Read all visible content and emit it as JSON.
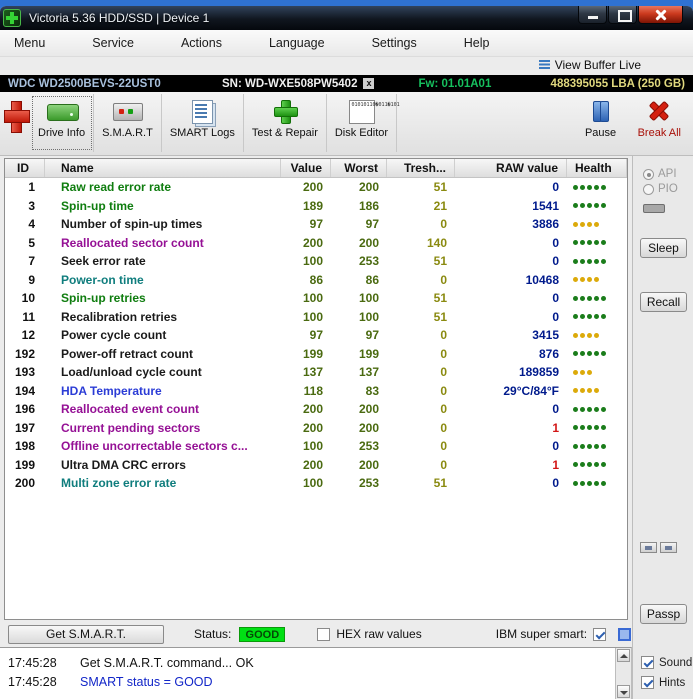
{
  "window": {
    "title": "Victoria 5.36 HDD/SSD | Device 1"
  },
  "menu": {
    "items": [
      "Menu",
      "Service",
      "Actions",
      "Language",
      "Settings",
      "Help"
    ]
  },
  "view_buffer_label": "View Buffer Live",
  "device_bar": {
    "model": "WDC WD2500BEVS-22UST0",
    "serial": "SN: WD-WXE508PW5402",
    "close_x": "x",
    "firmware": "Fw: 01.01A01",
    "capacity": "488395055 LBA (250 GB)"
  },
  "toolbar": {
    "buttons": [
      {
        "label": "Drive Info",
        "icon": "drive-info-icon"
      },
      {
        "label": "S.M.A.R.T",
        "icon": "smart-icon"
      },
      {
        "label": "SMART Logs",
        "icon": "smart-logs-icon"
      },
      {
        "label": "Test & Repair",
        "icon": "test-repair-icon"
      },
      {
        "label": "Disk Editor",
        "icon": "disk-editor-icon"
      }
    ],
    "pause_label": "Pause",
    "break_label": "Break All"
  },
  "table": {
    "headers": [
      "ID",
      "Name",
      "Value",
      "Worst",
      "Tresh...",
      "RAW value",
      "Health"
    ],
    "rows": [
      {
        "id": "1",
        "name": "Raw read error rate",
        "name_color": "#0f7d0f",
        "value": "200",
        "worst": "200",
        "tresh": "51",
        "raw": "0",
        "raw_color": "#001a8c",
        "dots": 5,
        "dot_color": "#1b7d1b"
      },
      {
        "id": "3",
        "name": "Spin-up time",
        "name_color": "#0f7d0f",
        "value": "189",
        "worst": "186",
        "tresh": "21",
        "raw": "1541",
        "raw_color": "#001a8c",
        "dots": 5,
        "dot_color": "#1b7d1b"
      },
      {
        "id": "4",
        "name": "Number of spin-up times",
        "name_color": "#1a1a1a",
        "value": "97",
        "worst": "97",
        "tresh": "0",
        "raw": "3886",
        "raw_color": "#001a8c",
        "dots": 4,
        "dot_color": "#dcaa0a"
      },
      {
        "id": "5",
        "name": "Reallocated sector count",
        "name_color": "#951095",
        "value": "200",
        "worst": "200",
        "tresh": "140",
        "raw": "0",
        "raw_color": "#001a8c",
        "dots": 5,
        "dot_color": "#1b7d1b"
      },
      {
        "id": "7",
        "name": "Seek error rate",
        "name_color": "#1a1a1a",
        "value": "100",
        "worst": "253",
        "tresh": "51",
        "raw": "0",
        "raw_color": "#001a8c",
        "dots": 5,
        "dot_color": "#1b7d1b"
      },
      {
        "id": "9",
        "name": "Power-on time",
        "name_color": "#0f7d7d",
        "value": "86",
        "worst": "86",
        "tresh": "0",
        "raw": "10468",
        "raw_color": "#001a8c",
        "dots": 4,
        "dot_color": "#dcaa0a"
      },
      {
        "id": "10",
        "name": "Spin-up retries",
        "name_color": "#0f7d0f",
        "value": "100",
        "worst": "100",
        "tresh": "51",
        "raw": "0",
        "raw_color": "#001a8c",
        "dots": 5,
        "dot_color": "#1b7d1b"
      },
      {
        "id": "11",
        "name": "Recalibration retries",
        "name_color": "#1a1a1a",
        "value": "100",
        "worst": "100",
        "tresh": "51",
        "raw": "0",
        "raw_color": "#001a8c",
        "dots": 5,
        "dot_color": "#1b7d1b"
      },
      {
        "id": "12",
        "name": "Power cycle count",
        "name_color": "#1a1a1a",
        "value": "97",
        "worst": "97",
        "tresh": "0",
        "raw": "3415",
        "raw_color": "#001a8c",
        "dots": 4,
        "dot_color": "#dcaa0a"
      },
      {
        "id": "192",
        "name": "Power-off retract count",
        "name_color": "#1a1a1a",
        "value": "199",
        "worst": "199",
        "tresh": "0",
        "raw": "876",
        "raw_color": "#001a8c",
        "dots": 5,
        "dot_color": "#1b7d1b"
      },
      {
        "id": "193",
        "name": "Load/unload cycle count",
        "name_color": "#1a1a1a",
        "value": "137",
        "worst": "137",
        "tresh": "0",
        "raw": "189859",
        "raw_color": "#001a8c",
        "dots": 3,
        "dot_color": "#dcaa0a"
      },
      {
        "id": "194",
        "name": "HDA Temperature",
        "name_color": "#2b3cd6",
        "value": "118",
        "worst": "83",
        "tresh": "0",
        "raw": "29°C/84°F",
        "raw_color": "#001a8c",
        "dots": 4,
        "dot_color": "#dcaa0a"
      },
      {
        "id": "196",
        "name": "Reallocated event count",
        "name_color": "#951095",
        "value": "200",
        "worst": "200",
        "tresh": "0",
        "raw": "0",
        "raw_color": "#001a8c",
        "dots": 5,
        "dot_color": "#1b7d1b"
      },
      {
        "id": "197",
        "name": "Current pending sectors",
        "name_color": "#951095",
        "value": "200",
        "worst": "200",
        "tresh": "0",
        "raw": "1",
        "raw_color": "#d21616",
        "dots": 5,
        "dot_color": "#1b7d1b"
      },
      {
        "id": "198",
        "name": "Offline uncorrectable sectors c...",
        "name_color": "#951095",
        "value": "100",
        "worst": "253",
        "tresh": "0",
        "raw": "0",
        "raw_color": "#001a8c",
        "dots": 5,
        "dot_color": "#1b7d1b"
      },
      {
        "id": "199",
        "name": "Ultra DMA CRC errors",
        "name_color": "#1a1a1a",
        "value": "200",
        "worst": "200",
        "tresh": "0",
        "raw": "1",
        "raw_color": "#d21616",
        "dots": 5,
        "dot_color": "#1b7d1b"
      },
      {
        "id": "200",
        "name": "Multi zone error rate",
        "name_color": "#0f7d7d",
        "value": "100",
        "worst": "253",
        "tresh": "51",
        "raw": "0",
        "raw_color": "#001a8c",
        "dots": 5,
        "dot_color": "#1b7d1b"
      }
    ]
  },
  "side_panel": {
    "api_label": "API",
    "pio_label": "PIO",
    "api_selected": true,
    "pio_selected": false,
    "sleep_label": "Sleep",
    "recall_label": "Recall",
    "passp_label": "Passp",
    "sound_label": "Sound",
    "hints_label": "Hints",
    "sound_checked": true,
    "hints_checked": true
  },
  "status_bar": {
    "get_smart_label": "Get S.M.A.R.T.",
    "status_label": "Status:",
    "status_value": "GOOD",
    "status_color": "#00e014",
    "hex_label": "HEX raw values",
    "hex_checked": false,
    "ibm_label": "IBM super smart:",
    "ibm_checked": true
  },
  "log": {
    "lines": [
      {
        "time": "17:45:28",
        "text": "Get S.M.A.R.T. command... OK",
        "color": "#111111"
      },
      {
        "time": "17:45:28",
        "text": "SMART status = GOOD",
        "color": "#1226c8"
      }
    ]
  },
  "icons": {
    "app-icon": "green-cross",
    "red-cross-icon": "victoria-red-cross",
    "buffer-list-icon": "blue-lines",
    "drive-info-icon": "green-drive",
    "smart-icon": "gray-drive-leds",
    "smart-logs-icon": "document-stack",
    "test-repair-icon": "green-plus",
    "disk-editor-icon": "binary-page",
    "pause-icon": "blue-pause-bars",
    "break-all-icon": "red-x",
    "minimize-icon": "dash",
    "maximize-icon": "square",
    "close-icon": "x"
  },
  "colors": {
    "health_green": "#1b7d1b",
    "health_yellow": "#dcaa0a",
    "raw_navy": "#001a8c",
    "raw_alert_red": "#d21616",
    "status_good_bg": "#00e014"
  }
}
